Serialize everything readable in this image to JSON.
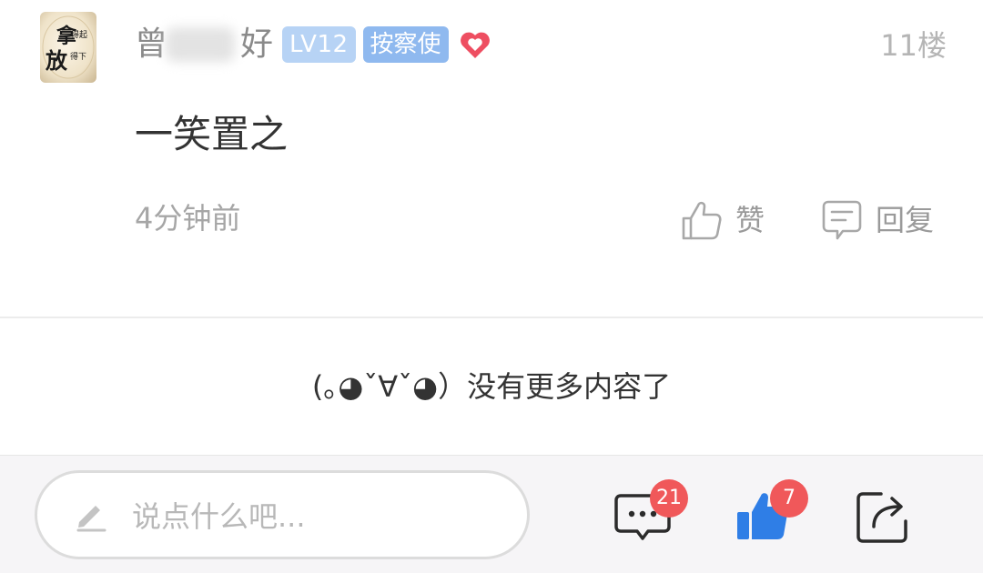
{
  "post": {
    "username": "曾  好",
    "username_first": "曾",
    "username_last": "好",
    "level_badge": "LV12",
    "role_badge": "按察使",
    "floor": "11楼",
    "content": "一笑置之",
    "time": "4分钟前",
    "like_label": "赞",
    "reply_label": "回复",
    "avatar_text": [
      "拿得起",
      "放得下"
    ]
  },
  "end_message": "(｡◕ˇ∀ˇ◕）没有更多内容了",
  "bottom_bar": {
    "input_placeholder": "说点什么吧...",
    "comment_count": "21",
    "like_count": "7"
  },
  "colors": {
    "level_badge_bg": "#b7d3f5",
    "role_badge_bg": "#8fb9ef",
    "heart": "#ee4e61",
    "like_thumb": "#2f7ee6",
    "count_badge": "#f0585a"
  }
}
